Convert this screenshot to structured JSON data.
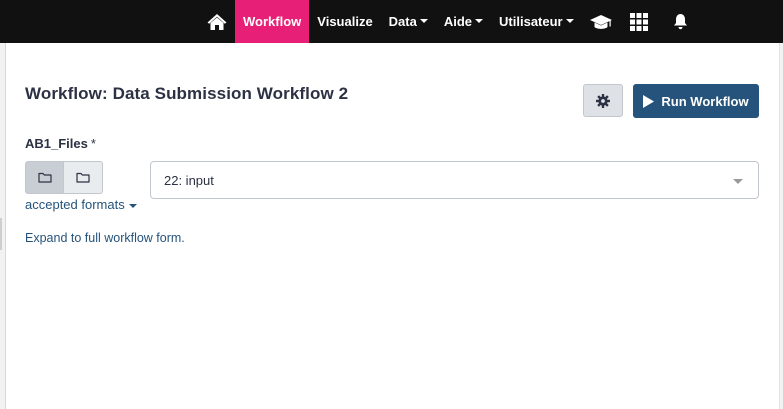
{
  "nav": {
    "items": [
      {
        "label": "Workflow",
        "active": true
      },
      {
        "label": "Visualize"
      },
      {
        "label": "Data",
        "dropdown": true
      },
      {
        "label": "Aide",
        "dropdown": true
      },
      {
        "label": "Utilisateur",
        "dropdown": true
      }
    ],
    "icons": [
      "home-icon",
      "graduation-cap-icon",
      "grid-icon",
      "bell-icon"
    ],
    "active_color": "#e81f76"
  },
  "workflow": {
    "title": "Workflow: Data Submission Workflow 2",
    "run_label": "Run Workflow",
    "settings_icon": "gear-icon"
  },
  "field": {
    "label": "AB1_Files",
    "required_mark": "*",
    "selected_value": "22: input",
    "accepted_formats": "accepted formats",
    "source_buttons": [
      "folder-icon",
      "folder-icon"
    ]
  },
  "expand_link": "Expand to full workflow form.",
  "colors": {
    "primary": "#25537b",
    "navbar": "#111111"
  }
}
